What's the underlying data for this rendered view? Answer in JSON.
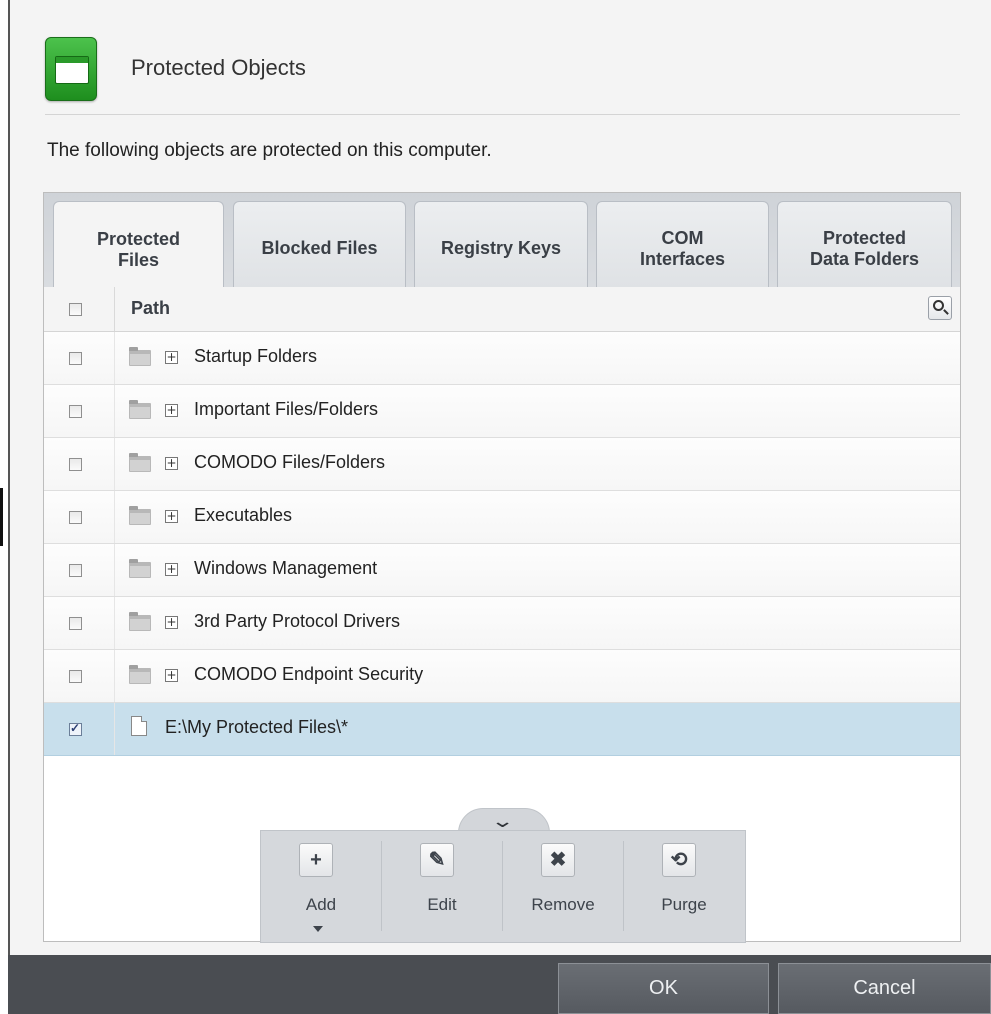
{
  "dialog": {
    "title": "Protected Objects",
    "description": "The following objects are protected on this computer."
  },
  "tabs": [
    {
      "label": "Protected\nFiles",
      "active": true
    },
    {
      "label": "Blocked Files",
      "active": false
    },
    {
      "label": "Registry Keys",
      "active": false
    },
    {
      "label": "COM\nInterfaces",
      "active": false
    },
    {
      "label": "Protected\nData Folders",
      "active": false
    }
  ],
  "table": {
    "column_path": "Path",
    "rows": [
      {
        "label": "Startup Folders",
        "type": "group",
        "checked": false
      },
      {
        "label": "Important Files/Folders",
        "type": "group",
        "checked": false
      },
      {
        "label": "COMODO Files/Folders",
        "type": "group",
        "checked": false
      },
      {
        "label": "Executables",
        "type": "group",
        "checked": false
      },
      {
        "label": "Windows Management",
        "type": "group",
        "checked": false
      },
      {
        "label": "3rd Party Protocol Drivers",
        "type": "group",
        "checked": false
      },
      {
        "label": "COMODO Endpoint Security",
        "type": "group",
        "checked": false
      },
      {
        "label": "E:\\My Protected Files\\*",
        "type": "file",
        "checked": true,
        "selected": true
      }
    ]
  },
  "toolbar": {
    "add": "Add",
    "edit": "Edit",
    "remove": "Remove",
    "purge": "Purge"
  },
  "footer": {
    "ok": "OK",
    "cancel": "Cancel"
  },
  "colors": {
    "accent_green": "#2a9a2a",
    "selected_row": "#c8dfec",
    "footer_bg": "#4a4d52"
  }
}
